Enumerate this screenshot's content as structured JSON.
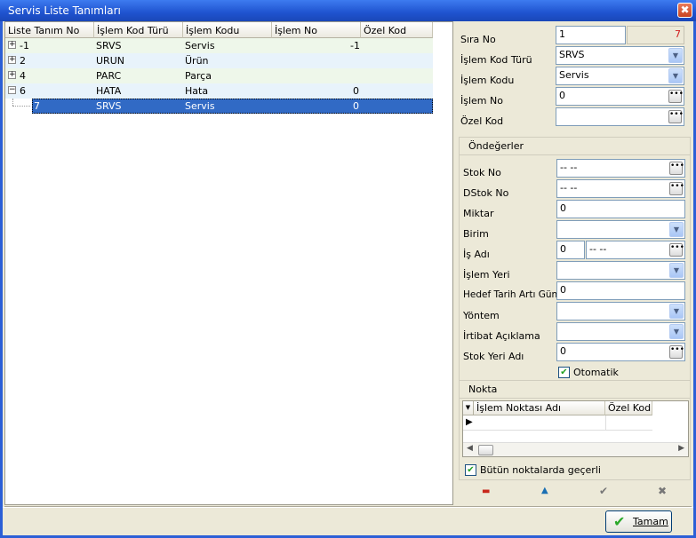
{
  "window": {
    "title": "Servis Liste Tanımları",
    "close_glyph": "✖"
  },
  "grid": {
    "columns": [
      "Liste Tanım No",
      "İşlem Kod Türü",
      "İşlem Kodu",
      "İşlem No",
      "Özel Kod"
    ],
    "rows": [
      {
        "expander": "+",
        "no": "-1",
        "tur": "SRVS",
        "kod": "Servis",
        "islemno": "-1",
        "ozel": ""
      },
      {
        "expander": "+",
        "no": "2",
        "tur": "URUN",
        "kod": "Ürün",
        "islemno": "",
        "ozel": ""
      },
      {
        "expander": "+",
        "no": "4",
        "tur": "PARC",
        "kod": "Parça",
        "islemno": "",
        "ozel": ""
      },
      {
        "expander": "−",
        "no": "6",
        "tur": "HATA",
        "kod": "Hata",
        "islemno": "0",
        "ozel": ""
      },
      {
        "expander": "",
        "no": "7",
        "tur": "SRVS",
        "kod": "Servis",
        "islemno": "0",
        "ozel": ""
      }
    ]
  },
  "form": {
    "sira_no_label": "Sıra No",
    "sira_no": "1",
    "sira_no_count": "7",
    "islem_kod_turu_label": "İşlem Kod Türü",
    "islem_kod_turu": "SRVS",
    "islem_kodu_label": "İşlem Kodu",
    "islem_kodu": "Servis",
    "islem_no_label": "İşlem No",
    "islem_no": "0",
    "ozel_kod_label": "Özel Kod",
    "ozel_kod": ""
  },
  "ondegerler": {
    "title": "Öndeğerler",
    "stok_no_label": "Stok No",
    "stok_no": "-- --",
    "dstok_no_label": "DStok No",
    "dstok_no": "-- --",
    "miktar_label": "Miktar",
    "miktar": "0",
    "birim_label": "Birim",
    "birim": "",
    "is_adi_label": "İş Adı",
    "is_adi_no": "0",
    "is_adi": "-- --",
    "islem_yeri_label": "İşlem Yeri",
    "islem_yeri": "",
    "hedef_label": "Hedef Tarih Artı Gün",
    "hedef": "0",
    "yontem_label": "Yöntem",
    "yontem": "",
    "irtibat_label": "İrtibat Açıklama",
    "irtibat": "",
    "stok_yeri_label": "Stok Yeri Adı",
    "stok_yeri": "0",
    "otomatik_label": "Otomatik"
  },
  "nokta": {
    "title": "Nokta",
    "columns": [
      "İşlem Noktası Adı",
      "Özel Kod"
    ],
    "all_points_label": "Bütün noktalarda geçerli"
  },
  "toolbar": {
    "remove": "▬",
    "up": "▲",
    "apply": "✔",
    "cancel": "✖"
  },
  "footer": {
    "ok_label": "Tamam",
    "ok_glyph": "✔"
  },
  "colors": {
    "selected_row": "#316ac5",
    "row_even": "#eef7ea",
    "row_odd": "#e8f3fb",
    "hidden_red": "#d22020"
  }
}
